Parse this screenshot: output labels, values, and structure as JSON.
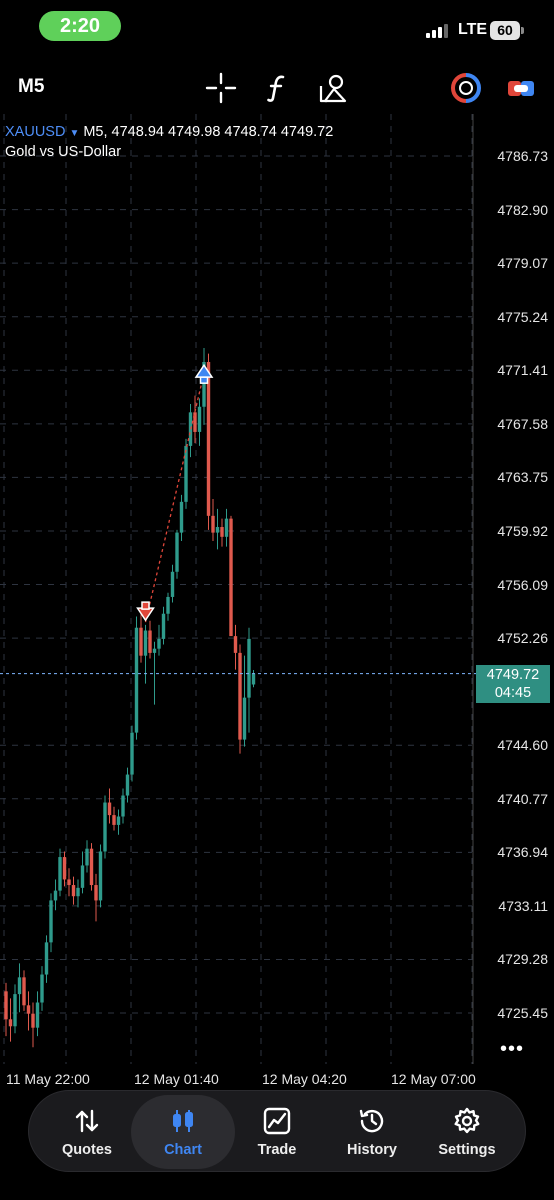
{
  "status_bar": {
    "time": "2:20",
    "network": "LTE",
    "battery": "60"
  },
  "toolbar": {
    "timeframe": "M5",
    "icons": [
      "crosshair-icon",
      "indicators-icon",
      "objects-icon",
      "trade-toggle-icon",
      "one-click-trade-icon"
    ]
  },
  "chart": {
    "symbol": "XAUUSD",
    "ohlc_line": "M5, 4748.94 4749.98 4748.74 4749.72",
    "description": "Gold vs US-Dollar",
    "current_price": "4749.72",
    "countdown": "04:45",
    "price_ticks": [
      "4786.73",
      "4782.90",
      "4779.07",
      "4775.24",
      "4771.41",
      "4767.58",
      "4763.75",
      "4759.92",
      "4756.09",
      "4752.26",
      "4744.60",
      "4740.77",
      "4736.94",
      "4733.11",
      "4729.28",
      "4725.45"
    ],
    "time_ticks": [
      "11 May 22:00",
      "12 May 01:40",
      "12 May 04:20",
      "12 May 07:00"
    ],
    "colors": {
      "bull": "#2f9b8c",
      "bear": "#e05a4e",
      "grid": "#2e3440",
      "sell_arrow": "#e0463a",
      "buy_arrow": "#3f86f2"
    },
    "more_label": "•••"
  },
  "chart_data": {
    "type": "candlestick",
    "symbol": "XAUUSD",
    "timeframe": "M5",
    "ylim": [
      4724,
      4788
    ],
    "last": 4749.72,
    "candles": [
      [
        4727.0,
        4727.6,
        4723.8,
        4725.0
      ],
      [
        4725.0,
        4726.5,
        4723.4,
        4724.5
      ],
      [
        4724.5,
        4727.5,
        4724.0,
        4726.8
      ],
      [
        4726.8,
        4729.0,
        4725.5,
        4728.0
      ],
      [
        4728.0,
        4728.5,
        4725.6,
        4726.0
      ],
      [
        4726.0,
        4727.0,
        4724.2,
        4725.4
      ],
      [
        4725.4,
        4726.2,
        4723.0,
        4724.4
      ],
      [
        4724.4,
        4727.0,
        4723.8,
        4726.2
      ],
      [
        4726.2,
        4728.8,
        4725.6,
        4728.2
      ],
      [
        4728.2,
        4731.0,
        4727.6,
        4730.5
      ],
      [
        4730.5,
        4734.0,
        4729.8,
        4733.5
      ],
      [
        4733.5,
        4735.0,
        4732.8,
        4734.2
      ],
      [
        4734.2,
        4737.2,
        4733.8,
        4736.6
      ],
      [
        4736.6,
        4737.0,
        4734.5,
        4735.0
      ],
      [
        4735.0,
        4735.8,
        4733.8,
        4734.6
      ],
      [
        4734.6,
        4735.2,
        4733.2,
        4733.8
      ],
      [
        4733.8,
        4735.0,
        4733.0,
        4734.4
      ],
      [
        4734.4,
        4737.0,
        4734.0,
        4736.0
      ],
      [
        4736.0,
        4737.8,
        4735.5,
        4737.2
      ],
      [
        4737.2,
        4737.6,
        4734.2,
        4734.6
      ],
      [
        4734.6,
        4735.4,
        4732.0,
        4733.5
      ],
      [
        4733.5,
        4737.5,
        4733.0,
        4737.0
      ],
      [
        4737.0,
        4741.0,
        4736.5,
        4740.5
      ],
      [
        4740.5,
        4741.5,
        4739.0,
        4739.6
      ],
      [
        4739.6,
        4740.2,
        4738.5,
        4738.9
      ],
      [
        4738.9,
        4740.0,
        4738.2,
        4739.5
      ],
      [
        4739.5,
        4741.5,
        4739.0,
        4741.0
      ],
      [
        4741.0,
        4743.0,
        4740.5,
        4742.5
      ],
      [
        4742.5,
        4746.0,
        4742.0,
        4745.5
      ],
      [
        4745.5,
        4753.8,
        4745.0,
        4753.0
      ],
      [
        4753.0,
        4754.0,
        4750.5,
        4751.0
      ],
      [
        4751.0,
        4753.2,
        4749.0,
        4752.8
      ],
      [
        4752.8,
        4753.5,
        4750.8,
        4751.2
      ],
      [
        4751.2,
        4752.0,
        4747.5,
        4751.5
      ],
      [
        4751.5,
        4753.2,
        4751.0,
        4752.2
      ],
      [
        4752.2,
        4754.5,
        4751.8,
        4754.0
      ],
      [
        4754.0,
        4755.5,
        4753.5,
        4755.2
      ],
      [
        4755.2,
        4757.5,
        4754.8,
        4757.0
      ],
      [
        4757.0,
        4760.0,
        4756.5,
        4759.8
      ],
      [
        4759.8,
        4762.5,
        4759.2,
        4762.0
      ],
      [
        4762.0,
        4766.5,
        4761.5,
        4766.0
      ],
      [
        4766.0,
        4769.0,
        4765.2,
        4768.4
      ],
      [
        4768.4,
        4769.6,
        4766.2,
        4767.0
      ],
      [
        4767.0,
        4769.4,
        4766.0,
        4768.8
      ],
      [
        4768.8,
        4773.0,
        4767.5,
        4772.0
      ],
      [
        4772.0,
        4772.6,
        4760.0,
        4761.0
      ],
      [
        4761.0,
        4762.2,
        4759.2,
        4759.8
      ],
      [
        4759.8,
        4761.5,
        4758.6,
        4760.2
      ],
      [
        4760.2,
        4760.8,
        4758.8,
        4759.5
      ],
      [
        4759.5,
        4761.5,
        4758.8,
        4760.8
      ],
      [
        4760.8,
        4761.0,
        4753.0,
        4752.4
      ],
      [
        4752.4,
        4753.2,
        4750.0,
        4751.2
      ],
      [
        4751.2,
        4751.8,
        4744.0,
        4745.0
      ],
      [
        4745.0,
        4751.0,
        4744.5,
        4748.0
      ],
      [
        4748.0,
        4753.0,
        4745.5,
        4752.2
      ],
      [
        4748.94,
        4749.98,
        4748.74,
        4749.72
      ]
    ],
    "signals": [
      {
        "type": "sell",
        "index": 31,
        "price": 4753.4
      },
      {
        "type": "buy",
        "index": 44,
        "price": 4771.2
      }
    ]
  },
  "bottom_nav": {
    "items": [
      {
        "label": "Quotes",
        "icon": "quotes-icon",
        "active": false
      },
      {
        "label": "Chart",
        "icon": "chart-icon",
        "active": true
      },
      {
        "label": "Trade",
        "icon": "trade-icon",
        "active": false
      },
      {
        "label": "History",
        "icon": "history-icon",
        "active": false
      },
      {
        "label": "Settings",
        "icon": "settings-icon",
        "active": false
      }
    ]
  }
}
